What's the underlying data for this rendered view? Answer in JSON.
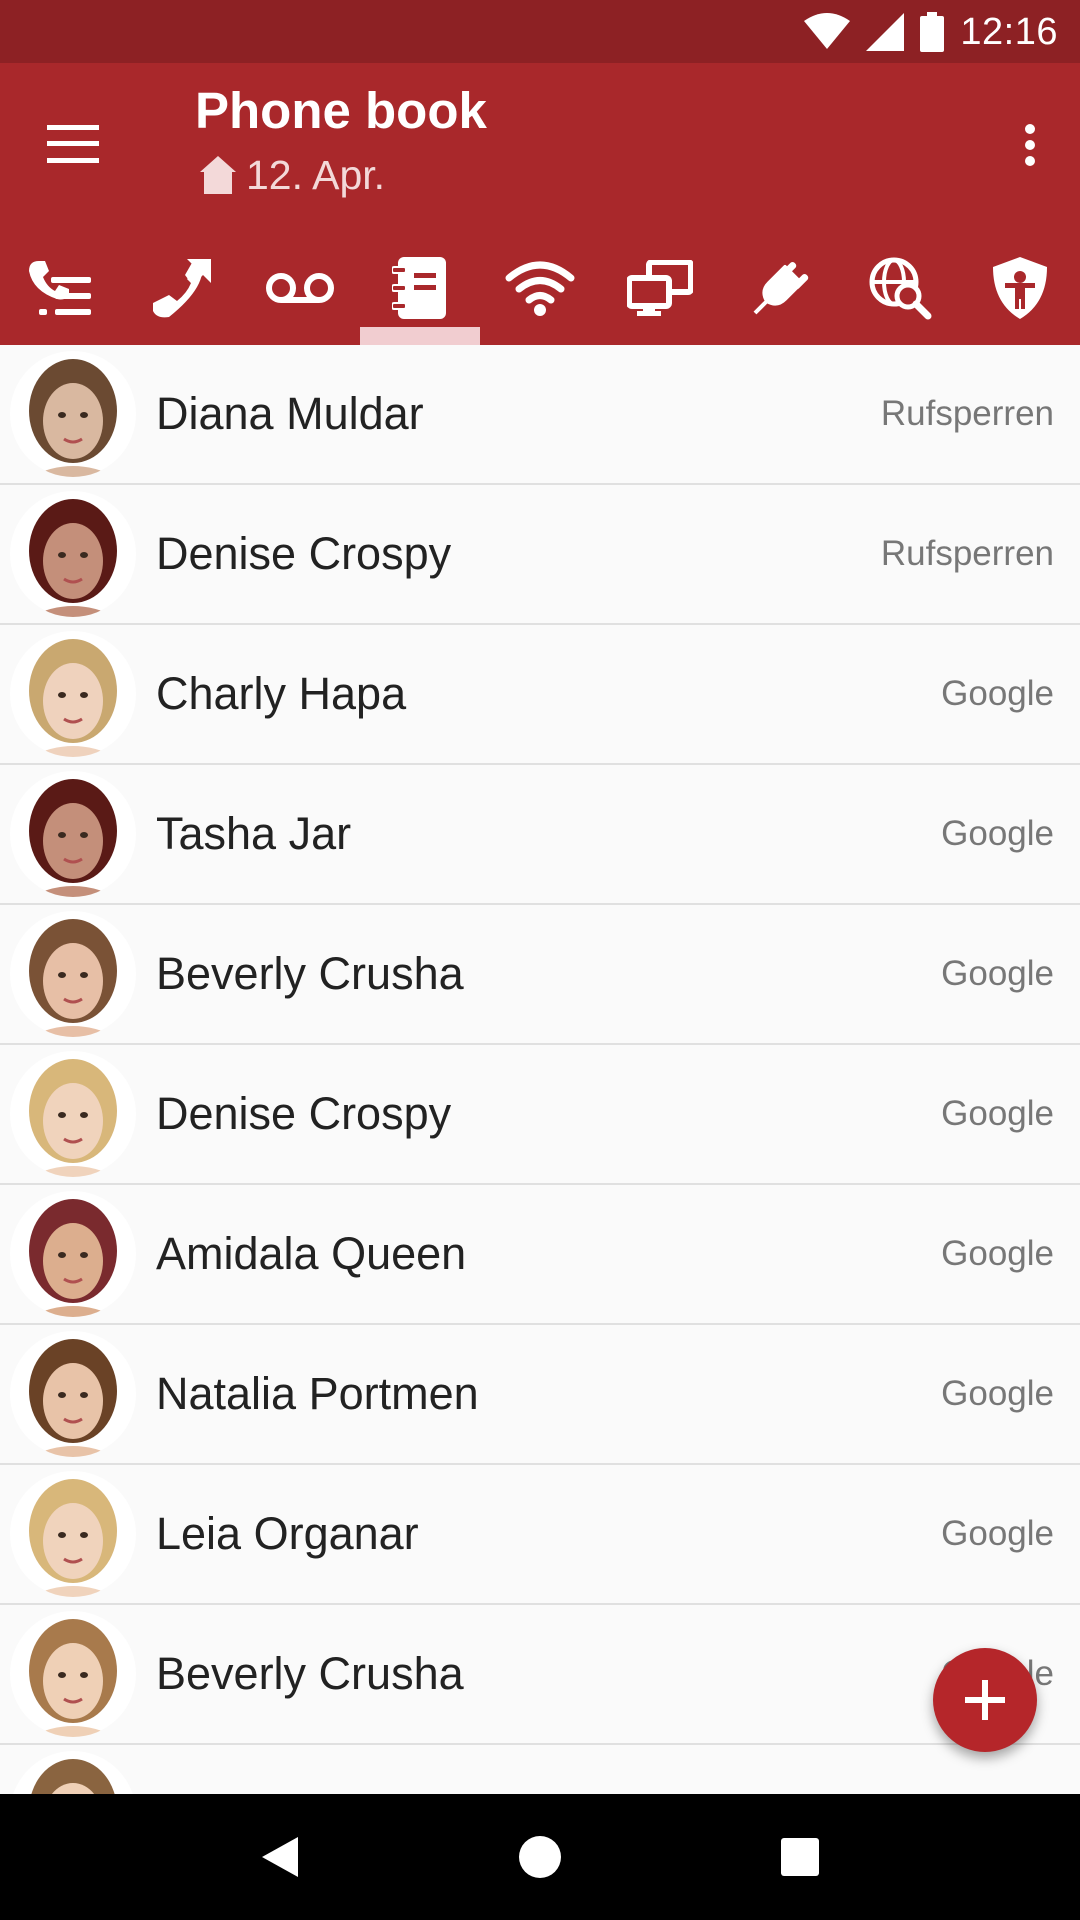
{
  "status_bar": {
    "time": "12:16"
  },
  "app_bar": {
    "title": "Phone book",
    "subtitle": "12. Apr."
  },
  "tabs": [
    {
      "icon": "call-list-icon",
      "selected": false
    },
    {
      "icon": "call-forward-icon",
      "selected": false
    },
    {
      "icon": "voicemail-icon",
      "selected": false
    },
    {
      "icon": "phonebook-icon",
      "selected": true
    },
    {
      "icon": "wifi-icon",
      "selected": false
    },
    {
      "icon": "devices-icon",
      "selected": false
    },
    {
      "icon": "plug-icon",
      "selected": false
    },
    {
      "icon": "web-search-icon",
      "selected": false
    },
    {
      "icon": "child-protection-icon",
      "selected": false
    }
  ],
  "contacts": [
    {
      "name": "Diana Muldar",
      "source": "Rufsperren",
      "avatar_colors": [
        "#d9b8a0",
        "#6b4a32"
      ]
    },
    {
      "name": "Denise Crospy",
      "source": "Rufsperren",
      "avatar_colors": [
        "#c48f7a",
        "#5a1a16"
      ]
    },
    {
      "name": "Charly Hapa",
      "source": "Google",
      "avatar_colors": [
        "#efd2bd",
        "#c9a870"
      ]
    },
    {
      "name": "Tasha Jar",
      "source": "Google",
      "avatar_colors": [
        "#c48f7a",
        "#5a1a16"
      ]
    },
    {
      "name": "Beverly Crusha",
      "source": "Google",
      "avatar_colors": [
        "#e7bfa6",
        "#7a5236"
      ]
    },
    {
      "name": "Denise Crospy",
      "source": "Google",
      "avatar_colors": [
        "#f0d3bc",
        "#d8b77a"
      ]
    },
    {
      "name": "Amidala Queen",
      "source": "Google",
      "avatar_colors": [
        "#dcae8e",
        "#7a2a2e"
      ]
    },
    {
      "name": "Natalia Portmen",
      "source": "Google",
      "avatar_colors": [
        "#e8c3a8",
        "#6a4226"
      ]
    },
    {
      "name": "Leia Organar",
      "source": "Google",
      "avatar_colors": [
        "#f0d3bc",
        "#d8b77a"
      ]
    },
    {
      "name": "Beverly Crusha",
      "source": "Google",
      "avatar_colors": [
        "#efd0b6",
        "#a87a4c"
      ]
    },
    {
      "name": "",
      "source": "",
      "avatar_colors": [
        "#efd0b6",
        "#8a6440"
      ]
    }
  ],
  "colors": {
    "app_bar": "#a9282b",
    "status_bar": "#8d2124",
    "fab": "#b5262a",
    "tab_indicator": "#f1cdd0"
  }
}
